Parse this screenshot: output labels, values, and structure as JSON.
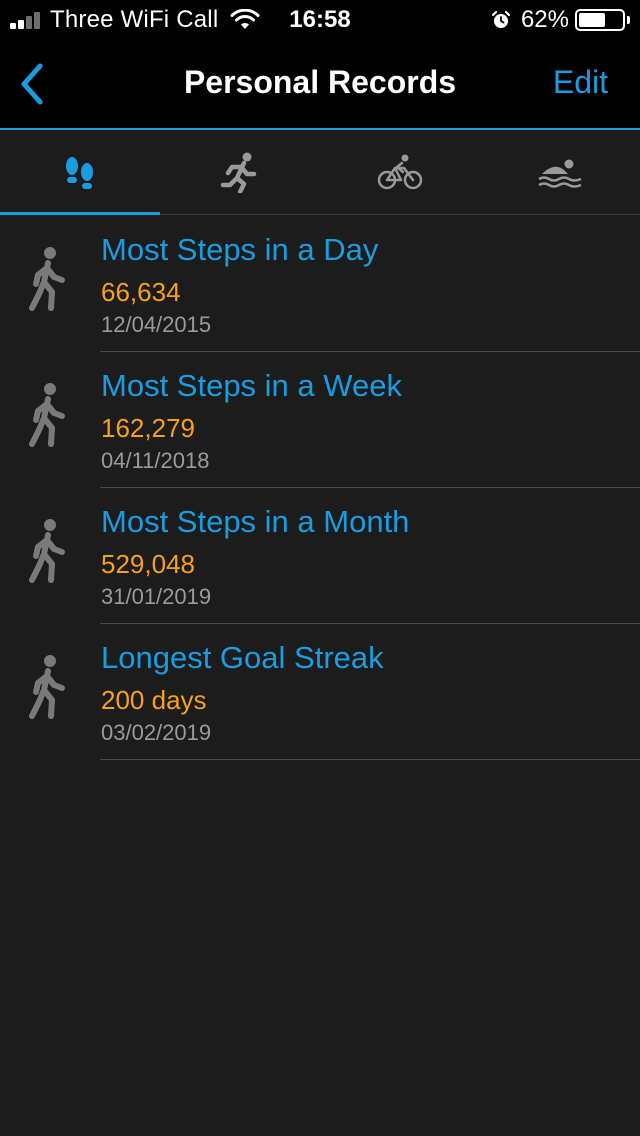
{
  "status_bar": {
    "carrier": "Three WiFi Call",
    "time": "16:58",
    "battery_percent": "62%",
    "battery_level": 0.62,
    "signal_bars_active": 2,
    "signal_bars_total": 4
  },
  "nav": {
    "title": "Personal Records",
    "edit_label": "Edit",
    "back_icon": "chevron-left-icon"
  },
  "tabs": [
    {
      "icon": "footsteps-icon",
      "active": true
    },
    {
      "icon": "running-icon",
      "active": false
    },
    {
      "icon": "cycling-icon",
      "active": false
    },
    {
      "icon": "swimming-icon",
      "active": false
    }
  ],
  "records": [
    {
      "title": "Most Steps in a Day",
      "value": "66,634",
      "date": "12/04/2015",
      "icon": "walking-icon"
    },
    {
      "title": "Most Steps in a Week",
      "value": "162,279",
      "date": "04/11/2018",
      "icon": "walking-icon"
    },
    {
      "title": "Most Steps in a Month",
      "value": "529,048",
      "date": "31/01/2019",
      "icon": "walking-icon"
    },
    {
      "title": "Longest Goal Streak",
      "value": "200 days",
      "date": "03/02/2019",
      "icon": "walking-icon"
    }
  ],
  "colors": {
    "accent": "#1a9ce0",
    "value": "#f7a11a",
    "date": "#9a9a9a",
    "background": "#1c1c1c",
    "bar": "#000000",
    "icon_inactive": "#9a9a9a",
    "record_icon": "#7a7a7a"
  }
}
